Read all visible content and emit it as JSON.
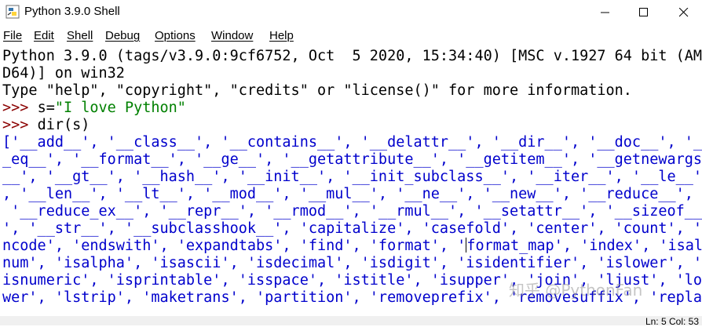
{
  "window": {
    "title": "Python 3.9.0 Shell",
    "icon": "python-idle-icon"
  },
  "menu": [
    "File",
    "Edit",
    "Shell",
    "Debug",
    "Options",
    "Window",
    "Help"
  ],
  "shell": {
    "banner": [
      "Python 3.9.0 (tags/v3.9.0:9cf6752, Oct  5 2020, 15:34:40) [MSC v.1927 64 bit (AM",
      "D64)] on win32",
      "Type \"help\", \"copyright\", \"credits\" or \"license()\" for more information."
    ],
    "prompt": ">>> ",
    "cmd1_code": "s=",
    "cmd1_string": "\"I love Python\"",
    "cmd2": "dir(s)",
    "output_lines": [
      "['__add__', '__class__', '__contains__', '__delattr__', '__dir__', '__doc__', '_",
      "_eq__', '__format__', '__ge__', '__getattribute__', '__getitem__', '__getnewargs",
      "__', '__gt__', '__hash__', '__init__', '__init_subclass__', '__iter__', '__le__'",
      ", '__len__', '__lt__', '__mod__', '__mul__', '__ne__', '__new__', '__reduce__',",
      " '__reduce_ex__', '__repr__', '__rmod__', '__rmul__', '__setattr__', '__sizeof__",
      "', '__str__', '__subclasshook__', 'capitalize', 'casefold', 'center', 'count', 'e",
      "ncode', 'endswith', 'expandtabs', 'find', 'format', '",
      "num', 'isalpha', 'isascii', 'isdecimal', 'isdigit', 'isidentifier', 'islower', '",
      "isnumeric', 'isprintable', 'isspace', 'istitle', 'isupper', 'join', 'ljust', 'lo",
      "wer', 'lstrip', 'maketrans', 'partition', 'removeprefix', 'removesuffix', 'repla"
    ],
    "line7_after_cursor": "format_map', 'index', 'isal"
  },
  "status": "Ln: 5  Col: 53",
  "watermark": "知乎 @PythonFan"
}
